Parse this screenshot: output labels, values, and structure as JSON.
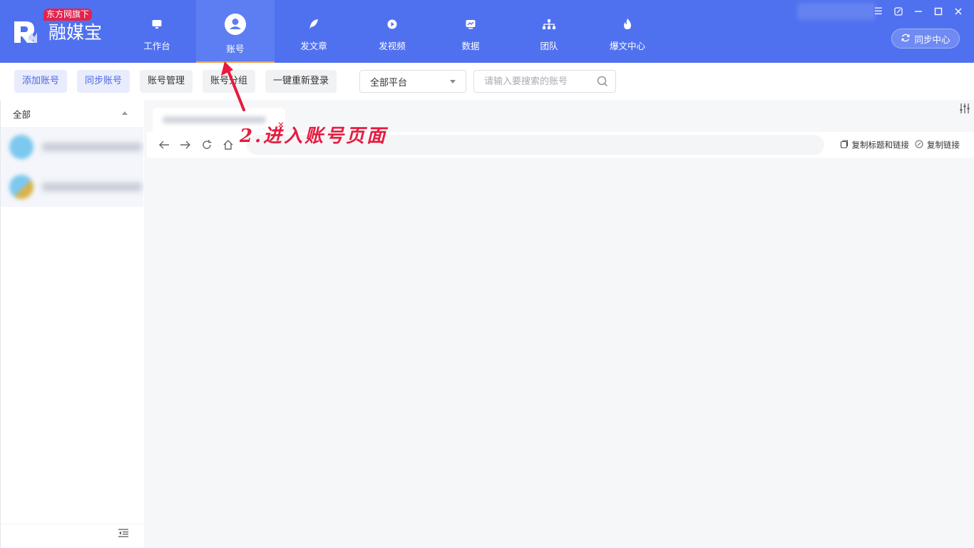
{
  "app": {
    "name": "融媒宝",
    "badge": "东方网旗下"
  },
  "nav": {
    "items": [
      {
        "label": "工作台",
        "icon": "monitor-icon"
      },
      {
        "label": "账号",
        "icon": "user-icon",
        "active": true
      },
      {
        "label": "发文章",
        "icon": "feather-icon"
      },
      {
        "label": "发视频",
        "icon": "play-icon"
      },
      {
        "label": "数据",
        "icon": "chart-icon"
      },
      {
        "label": "团队",
        "icon": "org-icon"
      },
      {
        "label": "爆文中心",
        "icon": "flame-icon"
      }
    ]
  },
  "header": {
    "sync_center": "同步中心"
  },
  "toolbar": {
    "add_account": "添加账号",
    "sync_account": "同步账号",
    "manage_account": "账号管理",
    "group_account": "账号分组",
    "relogin_all": "一键重新登录",
    "platform_select": "全部平台",
    "search_placeholder": "请输入要搜索的账号"
  },
  "sidebar": {
    "group_label": "全部"
  },
  "browser": {
    "copy_title_and_link": "复制标题和链接",
    "copy_link": "复制链接"
  },
  "annotation": {
    "text": "2.进入账号页面"
  },
  "colors": {
    "header_bg": "#5071ef",
    "active_underline": "#f0a04b",
    "badge": "#e2234c",
    "annotation": "#e51c3f",
    "primary_button_text": "#4b67e8"
  }
}
